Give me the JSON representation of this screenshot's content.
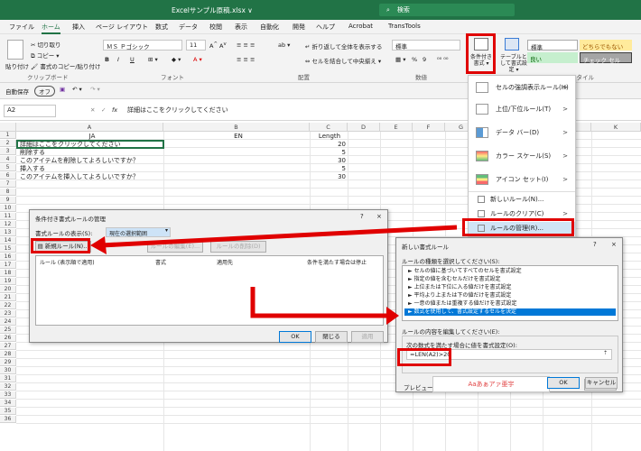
{
  "titlebar": {
    "filename": "Excelサンプル原稿.xlsx ∨",
    "search_placeholder": "検索"
  },
  "menu_tabs": [
    {
      "label": "ファイル"
    },
    {
      "label": "ホーム"
    },
    {
      "label": "挿入"
    },
    {
      "label": "ページ レイアウト"
    },
    {
      "label": "数式"
    },
    {
      "label": "データ"
    },
    {
      "label": "校閲"
    },
    {
      "label": "表示"
    },
    {
      "label": "自動化"
    },
    {
      "label": "開発"
    },
    {
      "label": "ヘルプ"
    },
    {
      "label": "Acrobat"
    },
    {
      "label": "TransTools"
    }
  ],
  "ribbon": {
    "paste": "貼り付け",
    "cut": "切り取り",
    "copy": "コピー ▾",
    "format_painter": "書式のコピー/貼り付け",
    "clipboard_group": "クリップボード",
    "font_name": "ＭＳ Ｐゴシック",
    "font_size": "11",
    "font_group": "フォント",
    "wrap_text": "折り返して全体を表示する",
    "merge_center": "セルを結合して中央揃え ▾",
    "alignment_group": "配置",
    "number_format": "標準",
    "number_group": "数値",
    "cond_format": "条件付き書式 ▾",
    "table_format": "テーブルとして書式設定 ▾",
    "style_normal": "標準",
    "style_neutral": "どちらでもない",
    "style_good": "良い",
    "style_check": "チェック セル",
    "style_group": "スタイル",
    "bold": "B",
    "italic": "I",
    "underline": "U",
    "percent": "%",
    "comma": "9"
  },
  "autosave": {
    "label": "自動保存",
    "toggle": "オフ"
  },
  "formula_bar": {
    "name_box": "A2",
    "fx": "fx",
    "content": "詳細はここをクリックしてください"
  },
  "columns": [
    "A",
    "B",
    "C",
    "D",
    "E",
    "F",
    "G",
    "H",
    "I",
    "J",
    "K"
  ],
  "rows": [
    "1",
    "2",
    "3",
    "4",
    "5",
    "6",
    "7",
    "8",
    "9",
    "10",
    "11",
    "12",
    "13",
    "14",
    "15",
    "16",
    "17",
    "18",
    "19",
    "20",
    "21",
    "22",
    "23",
    "24",
    "25",
    "26",
    "27",
    "28",
    "29",
    "30",
    "31",
    "32",
    "33",
    "34",
    "35",
    "36"
  ],
  "cells": {
    "a1": "JA",
    "b1": "EN",
    "c1": "Length",
    "a2": "詳細はここをクリックしてください",
    "c2": "20",
    "a3": "削除する",
    "c3": "5",
    "a4": "このアイテムを削除してよろしいですか？",
    "c4": "30",
    "a5": "挿入する",
    "c5": "5",
    "a6": "このアイテムを挿入してよろしいですか？",
    "c6": "30"
  },
  "cf_menu": [
    {
      "label": "セルの強調表示ルール(H)",
      "icon": "highlight-rules-icon",
      "arrow": ">"
    },
    {
      "label": "上位/下位ルール(T)",
      "icon": "top-bottom-rules-icon",
      "arrow": ">"
    },
    {
      "label": "データ バー(D)",
      "icon": "data-bars-icon",
      "arrow": ">"
    },
    {
      "label": "カラー スケール(S)",
      "icon": "color-scales-icon",
      "arrow": ">"
    },
    {
      "label": "アイコン セット(I)",
      "icon": "icon-sets-icon",
      "arrow": ">"
    }
  ],
  "cf_menu_small": [
    {
      "label": "新しいルール(N)..."
    },
    {
      "label": "ルールのクリア(C)",
      "arrow": ">"
    },
    {
      "label": "ルールの管理(R)..."
    }
  ],
  "manager_dialog": {
    "title": "条件付き書式ルールの管理",
    "help": "?",
    "close": "×",
    "show_label": "書式ルールの表示(S):",
    "show_value": "現在の選択範囲",
    "new_rule": "新規ルール(N)...",
    "edit_rule": "ルールの編集(E)...",
    "delete_rule": "ルールの削除(D)",
    "col_rule": "ルール (表示順で適用)",
    "col_format": "書式",
    "col_applies": "適用先",
    "col_stop": "条件を満たす場合は停止",
    "ok": "OK",
    "close_btn": "閉じる",
    "apply": "適用"
  },
  "new_rule_dialog": {
    "title": "新しい書式ルール",
    "help": "?",
    "close": "×",
    "type_label": "ルールの種類を選択してください(S):",
    "types": [
      "► セルの値に基づいてすべてのセルを書式設定",
      "► 指定の値を含むセルだけを書式設定",
      "► 上位または下位に入る値だけを書式設定",
      "► 平均より上または下の値だけを書式設定",
      "► 一意の値または重複する値だけを書式設定",
      "► 数式を使用して、書式設定するセルを決定"
    ],
    "edit_label": "ルールの内容を編集してください(E):",
    "formula_label": "次の数式を満たす場合に値を書式設定(O):",
    "formula": "=LEN(A2)>20",
    "preview_label": "プレビュー:",
    "preview_text": "Aaあぁアァ亜宇",
    "format_btn": "書式(F)...",
    "ok": "OK",
    "cancel": "キャンセル"
  },
  "colors": {
    "excel_green": "#217346",
    "highlight_red": "#e00000",
    "selection_blue": "#0078d7",
    "preview_red": "#e04040"
  }
}
